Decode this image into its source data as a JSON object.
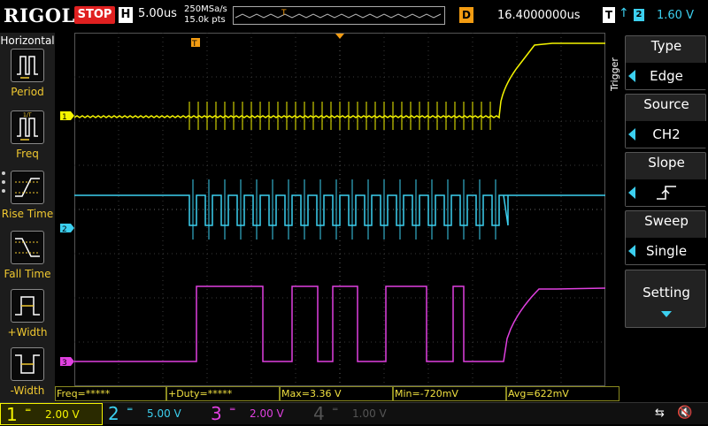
{
  "header": {
    "logo": "RIGOL",
    "run_state": "STOP",
    "timebase_badge": "H",
    "timebase": "5.00us",
    "sample_rate": "250MSa/s",
    "memory_depth": "15.0k pts",
    "delay_badge": "D",
    "delay": "16.4000000us",
    "trigger_badge": "T",
    "trigger_edge_glyph": "↑",
    "trigger_channel": "2",
    "trigger_level": "1.60 V"
  },
  "left_menu": {
    "title": "Horizontal",
    "items": [
      {
        "label": "Period",
        "icon": "period-icon"
      },
      {
        "label": "Freq",
        "icon": "frequency-icon"
      },
      {
        "label": "Rise Time",
        "icon": "rise-time-icon"
      },
      {
        "label": "Fall Time",
        "icon": "fall-time-icon"
      },
      {
        "label": "+Width",
        "icon": "positive-width-icon"
      },
      {
        "label": "-Width",
        "icon": "negative-width-icon"
      }
    ]
  },
  "right_menu": {
    "side_label": "Trigger",
    "items": [
      {
        "header": "Type",
        "value": "Edge"
      },
      {
        "header": "Source",
        "value": "CH2"
      },
      {
        "header": "Slope",
        "value": "rising-edge-icon"
      },
      {
        "header": "Sweep",
        "value": "Single"
      }
    ],
    "setting_label": "Setting"
  },
  "markers": {
    "ch1": "1",
    "ch2": "2",
    "ch3": "3",
    "trigger_pos": "T"
  },
  "measurements": [
    {
      "label": "Freq=*****"
    },
    {
      "label": "+Duty=*****"
    },
    {
      "label": "Max=3.36 V"
    },
    {
      "label": "Min=-720mV"
    },
    {
      "label": "Avg=622mV"
    }
  ],
  "channels": [
    {
      "num": "1",
      "coupling": "DC",
      "scale": "2.00 V",
      "color": "#f5f500",
      "active": true
    },
    {
      "num": "2",
      "coupling": "DC",
      "scale": "5.00 V",
      "color": "#3cd0f0",
      "active": true
    },
    {
      "num": "3",
      "coupling": "DC",
      "scale": "2.00 V",
      "color": "#e040e0",
      "active": true
    },
    {
      "num": "4",
      "coupling": "DC",
      "scale": "1.00 V",
      "color": "#555555",
      "active": false
    }
  ],
  "colors": {
    "ch1": "#f5f500",
    "ch2": "#3cd0f0",
    "ch3": "#e040e0",
    "trigger": "#f39c12"
  }
}
